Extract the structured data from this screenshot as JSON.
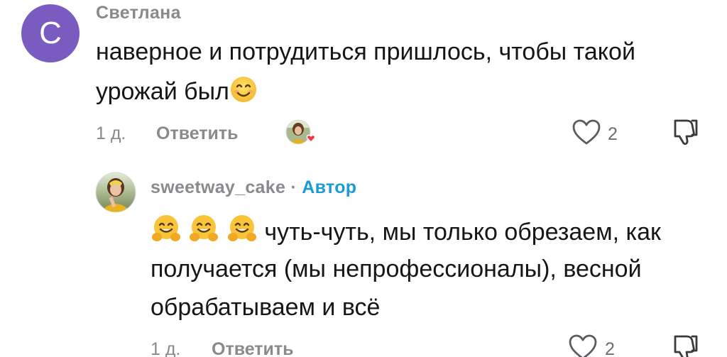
{
  "comment1": {
    "avatar_letter": "С",
    "username": "Светлана",
    "text_line1": "наверное и потрудиться пришлось, чтобы такой",
    "text_line2": "урожай был",
    "time": "1 д.",
    "reply_label": "Ответить",
    "like_count": "2"
  },
  "reply1": {
    "username": "sweetway_cake",
    "separator": "·",
    "author_badge": "Автор",
    "text_line1": "чуть-чуть, мы только обрезаем, как",
    "text_line2": "получается (мы непрофессионалы), весной",
    "text_line3": "обрабатываем и всё",
    "time": "1 д.",
    "reply_label": "Ответить",
    "like_count": "2"
  },
  "colors": {
    "avatar_bg": "#7a5bbf",
    "author_badge": "#1a9bd7",
    "heart_badge": "#ff3040",
    "meta_gray": "#8a8a8e"
  }
}
